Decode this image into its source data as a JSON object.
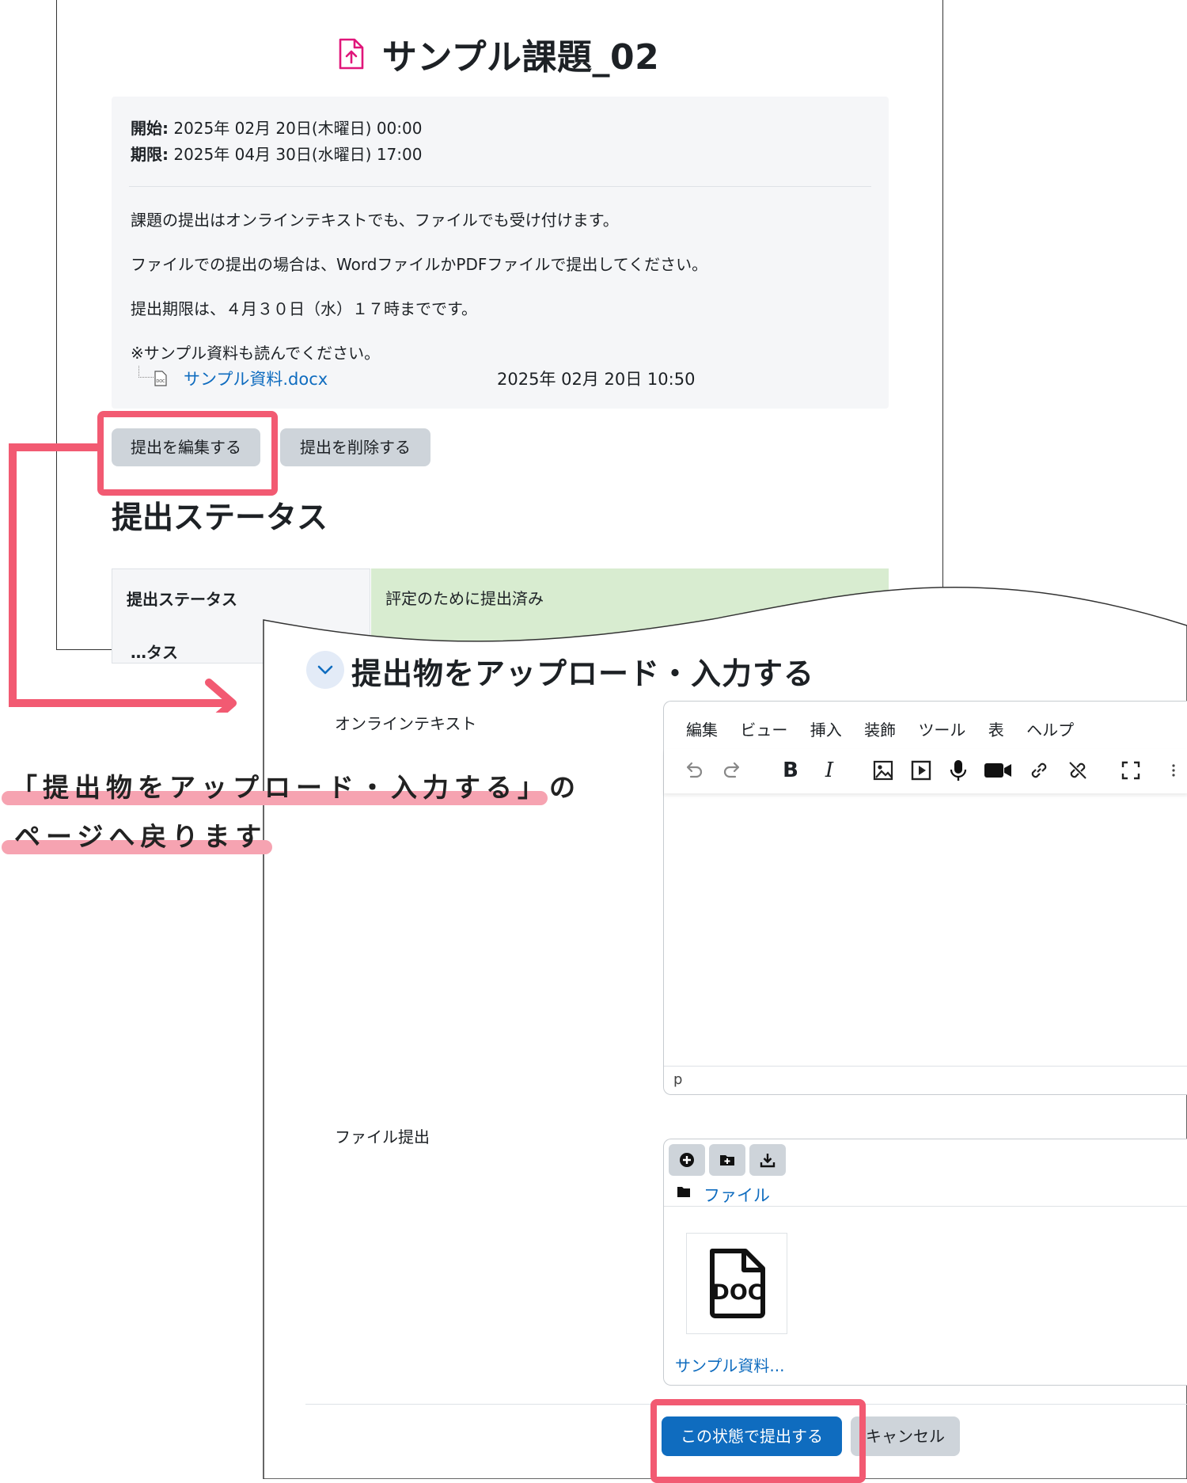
{
  "back_page": {
    "title": "サンプル課題_02",
    "dates": [
      {
        "label": "開始:",
        "value": " 2025年 02月 20日(木曜日) 00:00"
      },
      {
        "label": "期限:",
        "value": " 2025年 04月 30日(水曜日) 17:00"
      }
    ],
    "instructions": [
      "課題の提出はオンラインテキストでも、ファイルでも受け付けます。",
      "ファイルでの提出の場合は、WordファイルかPDFファイルで提出してください。",
      "提出期限は、４月３０日（水）１７時までです。",
      "※サンプル資料も読んでください。"
    ],
    "attachment": {
      "name": "サンプル資料.docx",
      "date": "2025年 02月 20日 10:50"
    },
    "buttons": {
      "edit": "提出を編集する",
      "delete": "提出を削除する"
    },
    "status_heading": "提出ステータス",
    "status_table": {
      "label": "提出ステータス",
      "value": "評定のために提出済み",
      "next_row_partial": "…タス"
    }
  },
  "form": {
    "heading": "提出物をアップロード・入力する",
    "online_text_label": "オンラインテキスト",
    "editor": {
      "menu": [
        "編集",
        "ビュー",
        "挿入",
        "装飾",
        "ツール",
        "表",
        "ヘルプ"
      ],
      "toolbar_icons": [
        "undo-icon",
        "redo-icon",
        "bold-icon",
        "italic-icon",
        "image-icon",
        "media-icon",
        "microphone-icon",
        "video-icon",
        "link-icon",
        "unlink-icon",
        "fullscreen-icon",
        "more-icon"
      ],
      "bold_glyph": "B",
      "italic_glyph": "I",
      "status_path": "p"
    },
    "file_label": "ファイル提出",
    "filepicker": {
      "buttons": [
        "add-file-icon",
        "create-folder-icon",
        "download-all-icon"
      ],
      "path": "ファイル",
      "file_icon_text": "DOC",
      "file_name": "サンプル資料..."
    },
    "submit_label": "この状態で提出する",
    "cancel_label": "キャンセル"
  },
  "annotation": {
    "line1": "「提出物をアップロード・入力する」の",
    "line2": "ページへ戻ります",
    "highlight_color": "#f25a72",
    "underline_color": "#f6a3b1"
  },
  "colors": {
    "link": "#0f6cbf",
    "primary_button": "#0f6cbf",
    "secondary_button": "#ced4da",
    "status_ok": "#d8ecd0",
    "assign_icon": "#e0167a"
  }
}
